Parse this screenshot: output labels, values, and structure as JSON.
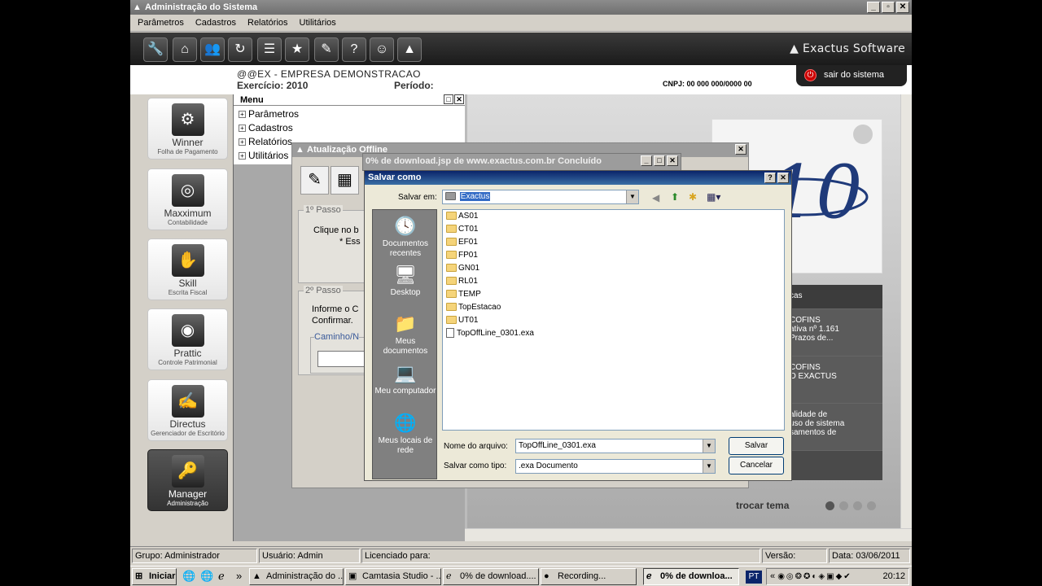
{
  "window": {
    "title": "Administração do Sistema",
    "min": "_",
    "restore": "▫",
    "close": "✕"
  },
  "menubar": [
    "Parâmetros",
    "Cadastros",
    "Relatórios",
    "Utilitários"
  ],
  "toolbar": {
    "icons": [
      "wrench-icon",
      "home-icon",
      "users-icon",
      "refresh-icon",
      "tree-icon",
      "star-icon",
      "edit-icon",
      "help-icon",
      "support-icon",
      "logo-icon"
    ],
    "glyphs": [
      "🔧",
      "⌂",
      "👥",
      "↻",
      "☰",
      "★",
      "✎",
      "?",
      "☺",
      "▲"
    ],
    "brand": "Exactus Software"
  },
  "header": {
    "company": "@@EX - EMPRESA DEMONSTRACAO",
    "exercicio": "Exercício: 2010",
    "periodo": "Período:",
    "cnpj": "CNPJ: 00 000 000/0000 00",
    "sair": "sair do sistema"
  },
  "modules": [
    {
      "name": "Winner",
      "sub": "Folha de Pagamento"
    },
    {
      "name": "Maxximum",
      "sub": "Contabilidade"
    },
    {
      "name": "Skill",
      "sub": "Escrita Fiscal"
    },
    {
      "name": "Prattic",
      "sub": "Controle Patrimonial"
    },
    {
      "name": "Directus",
      "sub": "Gerenciador de Escritório"
    },
    {
      "name": "Manager",
      "sub": "Administração"
    }
  ],
  "menupanel": {
    "title": "Menu",
    "items": [
      "Parâmetros",
      "Cadastros",
      "Relatórios",
      "Utilitários"
    ]
  },
  "promo": {
    "news": [
      "COFINS\nativa nº 1.161\nPrazos de...",
      "COFINS\nO EXACTUS",
      "alidade de\nuso de sistema\nsamentos de"
    ],
    "section": "cas",
    "trocar": "trocar tema"
  },
  "status": {
    "grupo": "Grupo: Administrador",
    "usuario": "Usuário: Admin",
    "licenciado": "Licenciado para:",
    "versao": "Versão:",
    "data": "Data: 03/06/2011"
  },
  "atualizacao": {
    "title": "Atualização Offline",
    "passo1": "1º Passo",
    "passo1_text1": "Clique no b",
    "passo1_text2": "* Ess",
    "passo2": "2º Passo",
    "passo2_text1": "Informe o C",
    "passo2_text2": "Confirmar.",
    "caminho": "Caminho/N"
  },
  "download": {
    "title": "0% de download.jsp de www.exactus.com.br Concluído"
  },
  "salvar": {
    "title": "Salvar como",
    "salvar_em_label": "Salvar em:",
    "salvar_em_value": "Exactus",
    "places": [
      "Documentos recentes",
      "Desktop",
      "Meus documentos",
      "Meu computador",
      "Meus locais de rede"
    ],
    "files": [
      {
        "name": "AS01",
        "type": "folder"
      },
      {
        "name": "CT01",
        "type": "folder"
      },
      {
        "name": "EF01",
        "type": "folder"
      },
      {
        "name": "FP01",
        "type": "folder"
      },
      {
        "name": "GN01",
        "type": "folder"
      },
      {
        "name": "RL01",
        "type": "folder"
      },
      {
        "name": "TEMP",
        "type": "folder"
      },
      {
        "name": "TopEstacao",
        "type": "folder"
      },
      {
        "name": "UT01",
        "type": "folder"
      },
      {
        "name": "TopOffLine_0301.exa",
        "type": "file"
      }
    ],
    "nome_label": "Nome do arquivo:",
    "nome_value": "TopOffLine_0301.exa",
    "tipo_label": "Salvar como tipo:",
    "tipo_value": ".exa Documento",
    "btn_salvar": "Salvar",
    "btn_cancelar": "Cancelar"
  },
  "taskbar": {
    "start": "Iniciar",
    "tasks": [
      "Administração do ...",
      "Camtasia Studio - ...",
      "0% de download....",
      "Recording...",
      "0% de downloa..."
    ],
    "lang": "PT",
    "clock": "20:12"
  }
}
